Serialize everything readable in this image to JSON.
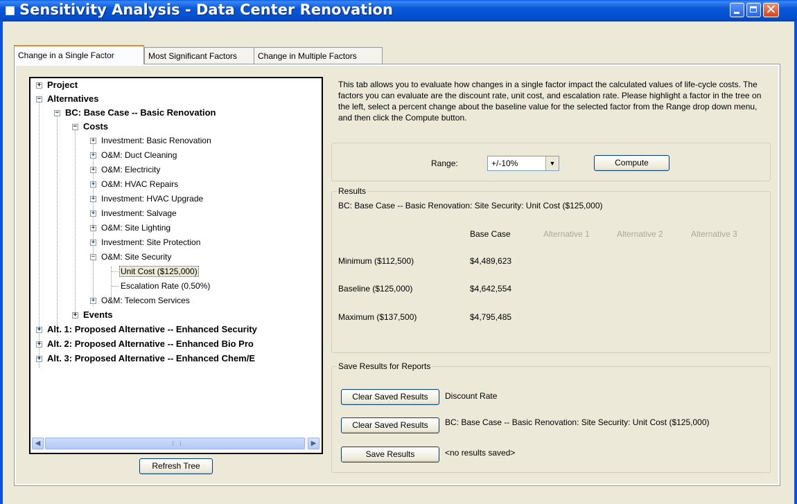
{
  "window": {
    "title": "Sensitivity Analysis - Data Center Renovation"
  },
  "tabs": [
    {
      "label": "Change in a Single Factor",
      "active": true
    },
    {
      "label": "Most Significant Factors",
      "active": false
    },
    {
      "label": "Change in Multiple Factors",
      "active": false
    }
  ],
  "tree": {
    "project": "Project",
    "alternatives": "Alternatives",
    "bc": "BC: Base Case -- Basic Renovation",
    "costs": "Costs",
    "cost_items": [
      "Investment: Basic Renovation",
      "O&M: Duct Cleaning",
      "O&M: Electricity",
      "O&M: HVAC Repairs",
      "Investment: HVAC Upgrade",
      "Investment: Salvage",
      "O&M: Site Lighting",
      "Investment: Site Protection",
      "O&M: Site Security"
    ],
    "unit_cost": "Unit Cost ($125,000)",
    "escalation": "Escalation Rate (0.50%)",
    "telecom": "O&M: Telecom Services",
    "events": "Events",
    "alt1": "Alt. 1: Proposed Alternative -- Enhanced Security",
    "alt2": "Alt. 2: Proposed Alternative -- Enhanced Bio Pro",
    "alt3": "Alt. 3: Proposed Alternative -- Enhanced Chem/E"
  },
  "refresh_button": "Refresh Tree",
  "description": "This tab allows you to evaluate how changes in a single factor impact the calculated values of life-cycle costs. The factors you can evaluate are the discount rate, unit cost, and escalation rate. Please highlight a factor in the tree on the left, select a percent change about the baseline value for the selected factor from the Range drop down menu, and then click the Compute button.",
  "range": {
    "label": "Range:",
    "value": "+/-10%",
    "compute_label": "Compute"
  },
  "results": {
    "title": "Results",
    "heading": "BC: Base Case -- Basic Renovation: Site Security:  Unit Cost ($125,000)",
    "columns": [
      "Base Case",
      "Alternative 1",
      "Alternative 2",
      "Alternative 3"
    ],
    "rows": [
      {
        "label": "Minimum  ($112,500)",
        "value": "$4,489,623"
      },
      {
        "label": "Baseline  ($125,000)",
        "value": "$4,642,554"
      },
      {
        "label": "Maximum  ($137,500)",
        "value": "$4,795,485"
      }
    ]
  },
  "save": {
    "title": "Save Results for Reports",
    "clear_label": "Clear Saved Results",
    "save_label": "Save Results",
    "line1": "Discount Rate",
    "line2": "BC: Base Case -- Basic Renovation: Site Security:  Unit Cost ($125,000)",
    "line3": "<no results saved>"
  },
  "colors": {
    "titlebar": "#0a58d8",
    "face": "#ece9d8",
    "tab_highlight": "#e68b2c",
    "disabled_text": "#aca899"
  },
  "icons": [
    "app-icon",
    "minimize-icon",
    "maximize-icon",
    "close-icon",
    "expand-icon",
    "collapse-icon",
    "chevron-down-icon",
    "scroll-left-icon",
    "scroll-right-icon"
  ]
}
